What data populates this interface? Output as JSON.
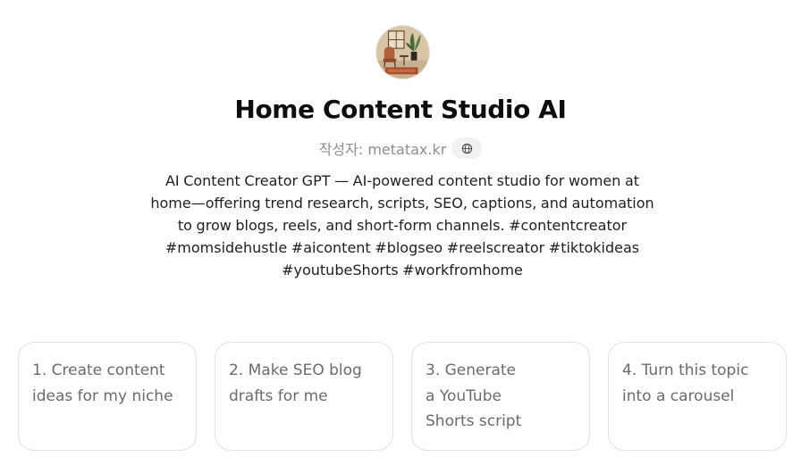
{
  "gpt": {
    "avatar_icon": "interior-room-illustration-icon",
    "title": "Home Content Studio AI",
    "author": "작성자: metatax.kr",
    "website_icon": "globe-icon",
    "description": "AI Content Creator GPT — AI-powered content studio for women at home—offering trend research, scripts, SEO, captions, and automation to grow blogs, reels, and short-form channels. #contentcreator #momsidehustle #aicontent #blogseo #reelscreator #tiktokideas #youtubeShorts #workfromhome"
  },
  "starters": [
    {
      "label": "1. Create content ideas for my niche"
    },
    {
      "label": "2. Make SEO blog drafts for me"
    },
    {
      "label": "3. Generate a YouTube Shorts script"
    },
    {
      "label": "4. Turn this topic into a carousel"
    }
  ]
}
